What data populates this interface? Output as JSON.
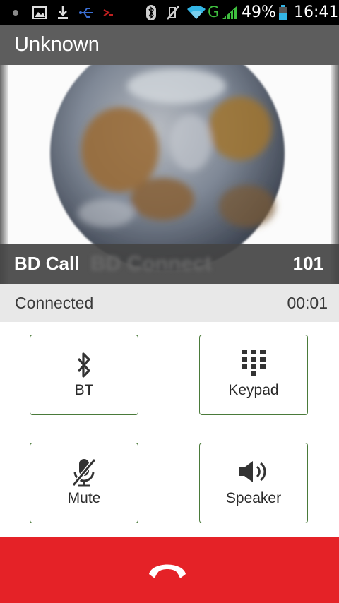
{
  "status_bar": {
    "battery": "49%",
    "time": "16:41",
    "network": "G",
    "icons": [
      "notification-dot-icon",
      "image-icon",
      "download-icon",
      "usb-icon",
      "app-icon",
      "bluetooth-icon",
      "mute-icon",
      "wifi-icon",
      "signal-icon",
      "battery-icon"
    ]
  },
  "app": {
    "title": "Unknown"
  },
  "caller": {
    "name": "BD Call",
    "number": "101",
    "avatar": "earth-globe-image"
  },
  "call": {
    "state": "Connected",
    "duration": "00:01"
  },
  "controls": [
    {
      "label": "BT",
      "icon": "bluetooth-icon"
    },
    {
      "label": "Keypad",
      "icon": "keypad-icon"
    },
    {
      "label": "Mute",
      "icon": "mic-off-icon"
    },
    {
      "label": "Speaker",
      "icon": "speaker-icon"
    }
  ],
  "end_call": {
    "icon": "hang-up-icon",
    "color": "#e52227"
  }
}
